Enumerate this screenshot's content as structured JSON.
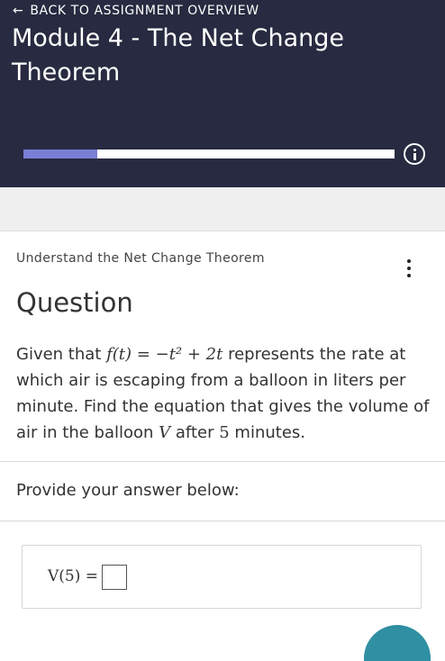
{
  "header": {
    "back_link": "BACK TO ASSIGNMENT OVERVIEW",
    "back_icon": "arrow-left-icon",
    "title": "Module 4 - The Net Change Theorem",
    "progress": 0.2,
    "info_icon": "info-icon",
    "background_color": "#272a40",
    "progress_fill_color": "#7a7fd6"
  },
  "section": {
    "label": "Understand the Net Change Theorem",
    "menu_icon": "more-vertical-icon"
  },
  "question": {
    "heading": "Question",
    "text_before_math": "Given that ",
    "function_lhs": "f(t)",
    "equals": "=",
    "function_rhs": "−t² + 2t",
    "text_mid": "represents the rate at which air is escaping from a balloon in liters per minute. Find the equation that  gives the volume of air in the balloon ",
    "volume_var": "V",
    "text_after": "after",
    "minutes_value": "5",
    "text_end": "minutes."
  },
  "answer": {
    "prompt": "Provide your answer below:",
    "label": "V(5) =",
    "value": ""
  }
}
